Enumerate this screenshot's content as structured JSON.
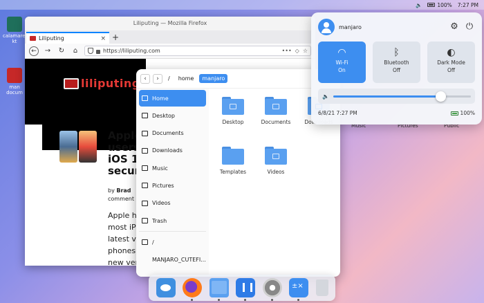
{
  "topbar": {
    "battery": "100%",
    "time": "7:27 PM"
  },
  "desktop": {
    "icons": [
      {
        "label": "calamares-\nkt",
        "icon": "calamares-installer-icon",
        "color": "#1f6f5b"
      },
      {
        "label": "man\ndocum",
        "icon": "pdf-document-icon",
        "color": "#c62828"
      }
    ]
  },
  "firefox": {
    "window_title": "Liliputing — Mozilla Firefox",
    "tab_title": "Liliputing",
    "url": "https://liliputing.com",
    "site_logo": "liliputing",
    "article_title": "Apple\nusers\niOS 1\nsecur",
    "byline_prefix": "by",
    "byline_author": "Brad",
    "byline_comments": "comment",
    "body_text": "Apple h\nmost iP\nlatest v\nphones\nnew ver"
  },
  "file_manager": {
    "breadcrumb": [
      "/",
      "home",
      "manjaro"
    ],
    "sidebar": [
      {
        "label": "Home",
        "icon": "home-icon",
        "active": true
      },
      {
        "label": "Desktop",
        "icon": "desktop-icon",
        "active": false
      },
      {
        "label": "Documents",
        "icon": "documents-icon",
        "active": false
      },
      {
        "label": "Downloads",
        "icon": "downloads-icon",
        "active": false
      },
      {
        "label": "Music",
        "icon": "music-icon",
        "active": false
      },
      {
        "label": "Pictures",
        "icon": "pictures-icon",
        "active": false
      },
      {
        "label": "Videos",
        "icon": "videos-icon",
        "active": false
      },
      {
        "label": "Trash",
        "icon": "trash-icon",
        "active": false
      }
    ],
    "devices": [
      {
        "label": "/",
        "icon": "drive-icon"
      },
      {
        "label": "MANJARO_CUTEFI...",
        "icon": "removable-drive-icon"
      }
    ],
    "files": [
      "Desktop",
      "Documents",
      "Downloads",
      "Music",
      "Pictures",
      "Public",
      "Templates",
      "Videos"
    ]
  },
  "control_center": {
    "user": "manjaro",
    "tiles": [
      {
        "label": "Wi-Fi",
        "state": "On",
        "icon": "wifi-icon",
        "on": true
      },
      {
        "label": "Bluetooth",
        "state": "Off",
        "icon": "bluetooth-icon",
        "on": false
      },
      {
        "label": "Dark Mode",
        "state": "Off",
        "icon": "dark-mode-icon",
        "on": false
      }
    ],
    "volume_level": 0.78,
    "datetime": "6/8/21 7:27 PM",
    "battery": "100%"
  },
  "dock": {
    "apps": [
      {
        "name": "dock-app-fish",
        "class": "app-fish",
        "running": false
      },
      {
        "name": "dock-app-firefox",
        "class": "app-fox",
        "running": true
      },
      {
        "name": "dock-app-files",
        "class": "app-files",
        "running": true
      },
      {
        "name": "dock-app-store",
        "class": "app-store",
        "running": true
      },
      {
        "name": "dock-app-settings",
        "class": "app-settings",
        "running": true
      },
      {
        "name": "dock-app-calculator",
        "class": "app-calc",
        "running": true
      },
      {
        "name": "dock-app-trash",
        "class": "app-trash",
        "running": false
      }
    ]
  }
}
